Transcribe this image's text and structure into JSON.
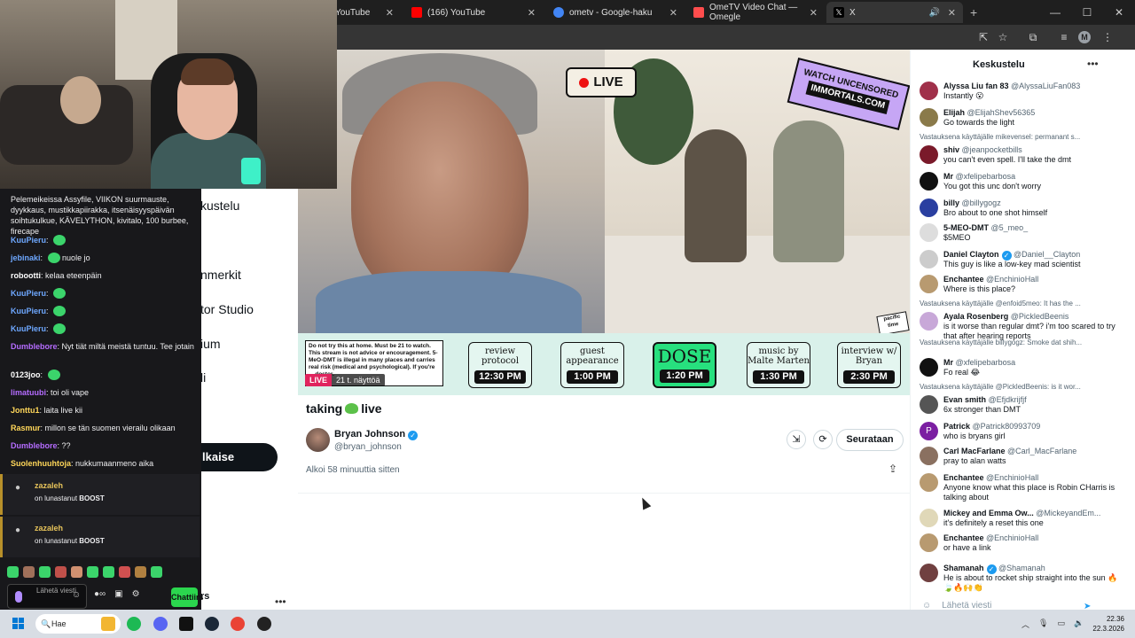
{
  "browser": {
    "tabs": [
      {
        "label": "YouTube",
        "color": "#ff0000",
        "active": false
      },
      {
        "label": "(166) YouTube",
        "color": "#ff0000",
        "active": false
      },
      {
        "label": "ometv - Google-haku",
        "color": "#4285f4",
        "active": false
      },
      {
        "label": "OmeTV Video Chat — Omegle",
        "color": "#ff4d4d",
        "active": false
      },
      {
        "label": "X",
        "color": "#000000",
        "active": true
      }
    ],
    "profile_initial": "M"
  },
  "x_nav": {
    "items": [
      "kustelu",
      "nmerkit",
      "tor Studio",
      "ium",
      "li"
    ],
    "post_label": "lkaise",
    "profile_name": "rs"
  },
  "broadcast": {
    "overlay": {
      "live_badge": "LIVE",
      "uncensored_line1": "WATCH UNCENSORED",
      "uncensored_line2": "IMMORTALS.COM",
      "disclaimer": "Do not try this at home. Must be 21 to watch. This stream is not advice or encouragement. 5-MeO-DMT is illegal in many places and carries real risk (medical and psychological). If you're ... doctor.",
      "schedule": [
        {
          "label": "review protocol",
          "time": "12:30 PM"
        },
        {
          "label": "guest appearance",
          "time": "1:00 PM"
        },
        {
          "label": "DOSE",
          "time": "1:20 PM"
        },
        {
          "label": "music by Malte Marten",
          "time": "1:30 PM"
        },
        {
          "label": "interview w/ Bryan",
          "time": "2:30 PM"
        }
      ],
      "timezone": "pacific time"
    },
    "live_tag": "LIVE",
    "viewers": "21 t. näyttöä",
    "title_before": "taking",
    "title_after": "live",
    "host_name": "Bryan Johnson",
    "host_handle": "@bryan_johnson",
    "follow_label": "Seurataan",
    "started": "Alkoi 58 minuuttia sitten"
  },
  "x_chat": {
    "header": "Keskustelu",
    "input_placeholder": "Lähetä viesti",
    "messages": [
      {
        "type": "msg",
        "name": "Alyssa Liu fan 83",
        "handle": "@AlyssaLiuFan083",
        "text": "Instantly 😮",
        "color": "#a0304a"
      },
      {
        "type": "msg",
        "name": "Elijah",
        "handle": "@ElijahShev56365",
        "text": "Go towards the light",
        "color": "#8a7a4a"
      },
      {
        "type": "reply",
        "text": "Vastauksena käyttäjälle mikevensel: permanant s..."
      },
      {
        "type": "msg",
        "name": "shiv",
        "handle": "@jeanpocketbills",
        "text": "you can't even spell. I'll take the dmt",
        "color": "#7a1a2a"
      },
      {
        "type": "msg",
        "name": "Mr",
        "handle": "@xfelipebarbosa",
        "text": "You got this unc don't worry",
        "color": "#111111"
      },
      {
        "type": "msg",
        "name": "billy",
        "handle": "@billygogz",
        "text": "Bro about to one shot himself",
        "color": "#2a3fa0"
      },
      {
        "type": "msg",
        "name": "5-MEO-DMT",
        "handle": "@5_meo_",
        "text": "$5MEO",
        "color": "#dddddd"
      },
      {
        "type": "msg",
        "name": "Daniel Clayton",
        "handle": "@Daniel__Clayton",
        "text": "This guy is like a low-key mad scientist",
        "color": "#cccccc",
        "verified": true
      },
      {
        "type": "msg",
        "name": "Enchantee",
        "handle": "@EnchinioHall",
        "text": "Where is this place?",
        "color": "#b89a70"
      },
      {
        "type": "reply",
        "text": "Vastauksena käyttäjälle @enfoid5meo: It has the ..."
      },
      {
        "type": "msg",
        "name": "Ayala Rosenberg",
        "handle": "@PickledBeenis",
        "text": "is it worse than regular dmt? i'm too scared to try that after hearing reports",
        "color": "#c8a8d8"
      },
      {
        "type": "reply",
        "text": "Vastauksena käyttäjälle billygogz: Smoke dat shih..."
      },
      {
        "type": "msg",
        "name": "Mr",
        "handle": "@xfelipebarbosa",
        "text": "Fo real 😂",
        "color": "#111111"
      },
      {
        "type": "reply",
        "text": "Vastauksena käyttäjälle @PickledBeenis: is it wor..."
      },
      {
        "type": "msg",
        "name": "Evan smith",
        "handle": "@Efjdkrijfjf",
        "text": "6x stronger than DMT",
        "color": "#555555"
      },
      {
        "type": "msg",
        "name": "Patrick",
        "handle": "@Patrick80993709",
        "text": "who is bryans girl",
        "color": "#7b1fa2",
        "initial": "P"
      },
      {
        "type": "msg",
        "name": "Carl MacFarlane",
        "handle": "@Carl_MacFarlane",
        "text": "pray to alan watts",
        "color": "#8a7060"
      },
      {
        "type": "msg",
        "name": "Enchantee",
        "handle": "@EnchinioHall",
        "text": "Anyone know what this place is Robin CHarris is talking about",
        "color": "#b89a70"
      },
      {
        "type": "msg",
        "name": "Mickey and Emma Ow...",
        "handle": "@MickeyandEm...",
        "text": "it's definitely a reset this one",
        "color": "#e0d8b8"
      },
      {
        "type": "msg",
        "name": "Enchantee",
        "handle": "@EnchinioHall",
        "text": "or have a link",
        "color": "#b89a70"
      },
      {
        "type": "msg",
        "name": "Shamanah",
        "handle": "@Shamanah",
        "text": "He is about to rocket ship straight into the sun 🔥🍃🔥🙌👏",
        "color": "#704040",
        "verified": true
      }
    ]
  },
  "twitch_chat": {
    "lines": [
      {
        "user": "",
        "text": "Pelemeikeissa Assyfile, VIIKON suurmauste, dyykkaus, mustikkapiirakka, itsenäisyyspäivän soihtukulkue, KÄVELYTHON, kivitalo, 100 burbee, firecape",
        "color": "#ffffff",
        "emote": false
      },
      {
        "user": "KuuPieru",
        "text": "",
        "color": "#6ea8ff",
        "emote": true
      },
      {
        "user": "jebinaki",
        "text": "nuole jo",
        "color": "#6ea8ff",
        "emote": true
      },
      {
        "user": "robootti",
        "text": "kelaa eteenpäin",
        "color": "#ffffff",
        "emote": false
      },
      {
        "user": "KuuPieru",
        "text": "",
        "color": "#6ea8ff",
        "emote": true
      },
      {
        "user": "KuuPieru",
        "text": "",
        "color": "#6ea8ff",
        "emote": true
      },
      {
        "user": "KuuPieru",
        "text": "",
        "color": "#6ea8ff",
        "emote": true
      },
      {
        "user": "Dumblebore",
        "text": "Nyt tiät miltä meistä tuntuu. Tee jotain",
        "color": "#b56cff",
        "emote": false
      },
      {
        "user": "0123joo",
        "text": "",
        "color": "#ffffff",
        "emote": true
      },
      {
        "user": "limatuubi",
        "text": "toi oli vape",
        "color": "#b56cff",
        "emote": false
      },
      {
        "user": "Jonttu1",
        "text": "laita live kii",
        "color": "#ffd75a",
        "emote": false
      },
      {
        "user": "Rasmur",
        "text": "millon se tän suomen vierailu olikaan",
        "color": "#ffd75a",
        "emote": false
      },
      {
        "user": "Dumblebore",
        "text": "??",
        "color": "#b56cff",
        "emote": false
      },
      {
        "user": "Suolenhuuhtoja",
        "text": "nukkumaanmeno aika",
        "color": "#ffd75a",
        "emote": false
      }
    ],
    "boosts": [
      {
        "user": "zazaleh",
        "text_prefix": "on lunastanut",
        "reward": "BOOST"
      },
      {
        "user": "zazaleh",
        "text_prefix": "on lunastanut",
        "reward": "BOOST"
      }
    ],
    "input_placeholder": "Lähetä viesti",
    "chat_button": "Chattiirs"
  },
  "taskbar": {
    "search_label": "Hae",
    "time": "22.36",
    "date": "22.3.2026"
  }
}
